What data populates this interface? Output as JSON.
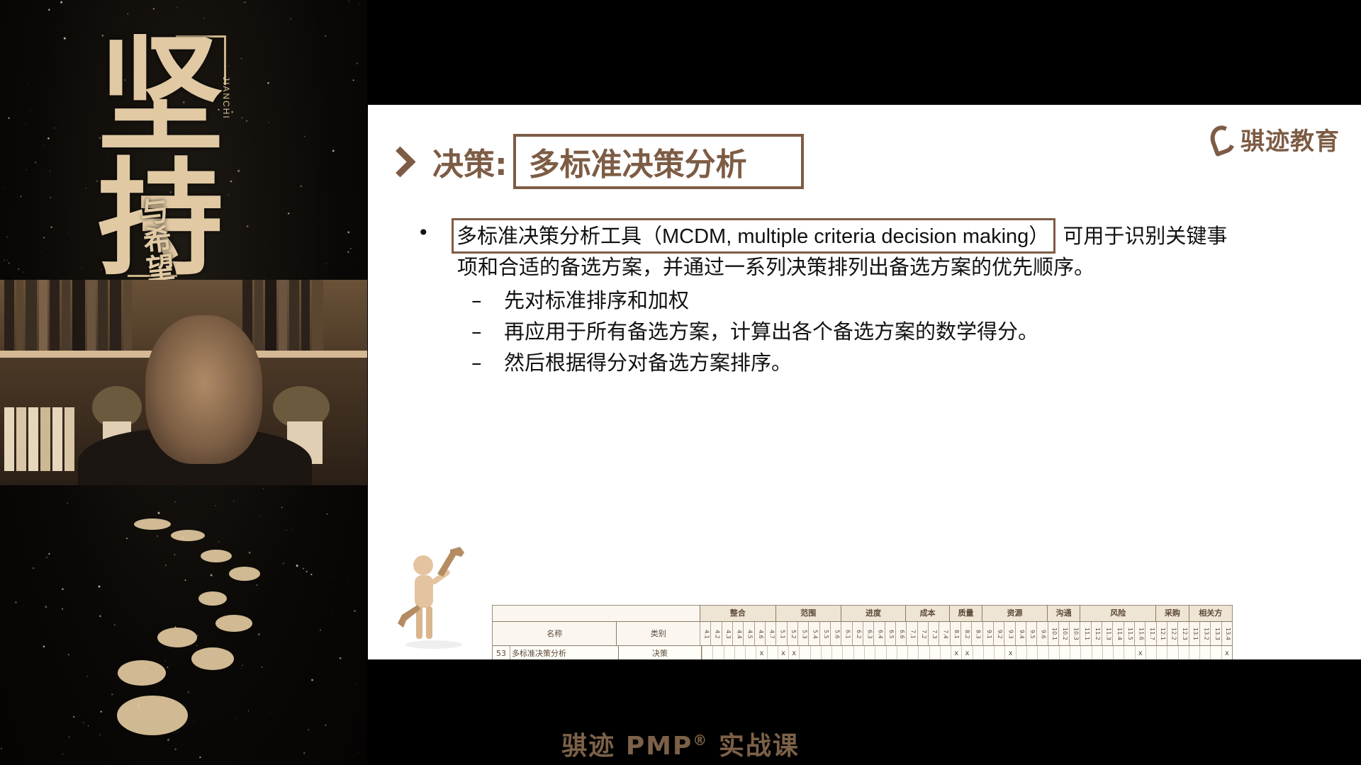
{
  "left_panel": {
    "calligraphy_main": "坚持",
    "calligraphy_sub": "与希望",
    "vertical_label": "JIANCHI"
  },
  "slide": {
    "title_prefix": "决策:",
    "title_boxed": "多标准决策分析",
    "logo_text": "骐迹教育",
    "bullet": {
      "highlighted": "多标准决策分析工具（MCDM, multiple criteria decision making）",
      "rest_line1": "可用于识别关键事",
      "rest_line2": "项和合适的备选方案，并通过一系列决策排列出备选方案的优先顺序。"
    },
    "sub_items": [
      "先对标准排序和加权",
      "再应用于所有备选方案，计算出各个备选方案的数学得分。",
      "然后根据得分对备选方案排序。"
    ],
    "matrix": {
      "header_name": "名称",
      "header_category": "类别",
      "groups": [
        "整合",
        "范围",
        "进度",
        "成本",
        "质量",
        "资源",
        "沟通",
        "风险",
        "采购",
        "相关方"
      ],
      "columns": [
        "4.1",
        "4.2",
        "4.3",
        "4.4",
        "4.5",
        "4.6",
        "4.7",
        "5.1",
        "5.2",
        "5.3",
        "5.4",
        "5.5",
        "5.6",
        "6.1",
        "6.2",
        "6.3",
        "6.4",
        "6.5",
        "6.6",
        "7.1",
        "7.2",
        "7.3",
        "7.4",
        "8.1",
        "8.2",
        "8.3",
        "9.1",
        "9.2",
        "9.3",
        "9.4",
        "9.5",
        "9.6",
        "10.1",
        "10.2",
        "10.3",
        "11.1",
        "11.2",
        "11.3",
        "11.4",
        "11.5",
        "11.6",
        "11.7",
        "12.1",
        "12.2",
        "12.3",
        "13.1",
        "13.2",
        "13.3",
        "13.4"
      ],
      "row": {
        "number": "53",
        "name": "多标准决策分析",
        "category": "决策",
        "marks": [
          "",
          "",
          "",
          "",
          "",
          "x",
          "",
          "x",
          "x",
          "",
          "",
          "",
          "",
          "",
          "",
          "",
          "",
          "",
          "",
          "",
          "",
          "",
          "",
          "x",
          "x",
          "",
          "",
          "",
          "x",
          "",
          "",
          "",
          "",
          "",
          "",
          "",
          "",
          "",
          "",
          "",
          "x",
          "",
          "",
          "",
          "",
          "",
          "",
          "",
          "x"
        ]
      }
    }
  },
  "bottom_caption": {
    "text": "骐迹 PMP",
    "reg": "®",
    "suffix": " 实战课"
  },
  "colors": {
    "accent": "#7d5c45",
    "background": "#000000",
    "slide_bg": "#ffffff",
    "gold": "#e1c9a4"
  }
}
